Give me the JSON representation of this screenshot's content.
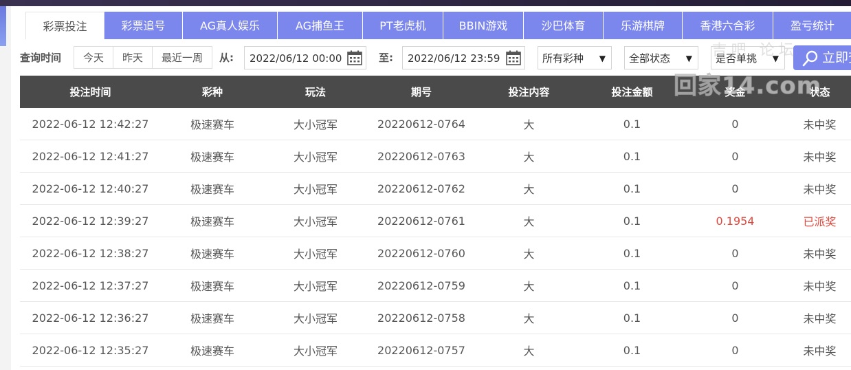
{
  "colors": {
    "accent": "#7c87ee",
    "header_bg": "#4a4a4a",
    "win_red": "#e0483d"
  },
  "tabs": [
    {
      "label": "彩票投注",
      "active": true
    },
    {
      "label": "彩票追号",
      "active": false
    },
    {
      "label": "AG真人娱乐",
      "active": false
    },
    {
      "label": "AG捕鱼王",
      "active": false
    },
    {
      "label": "PT老虎机",
      "active": false
    },
    {
      "label": "BBIN游戏",
      "active": false
    },
    {
      "label": "沙巴体育",
      "active": false
    },
    {
      "label": "乐游棋牌",
      "active": false
    },
    {
      "label": "香港六合彩",
      "active": false
    },
    {
      "label": "盈亏统计",
      "active": false
    }
  ],
  "filter": {
    "query_time_label": "查询时间",
    "quick": [
      "今天",
      "昨天",
      "最近一周"
    ],
    "from_label": "从:",
    "from_value": "2022/06/12 00:00",
    "to_label": "至:",
    "to_value": "2022/06/12 23:59",
    "lottery_select": "所有彩种",
    "status_select": "全部状态",
    "single_select": "是否单挑",
    "search_label": "立即查询",
    "calendar_icon": "calendar-icon",
    "search_icon": "search-icon"
  },
  "table": {
    "headers": [
      "投注时间",
      "彩种",
      "玩法",
      "期号",
      "投注内容",
      "投注金额",
      "奖金",
      "状态"
    ],
    "rows": [
      [
        "2022-06-12 12:42:27",
        "极速赛车",
        "大小冠军",
        "20220612-0764",
        "大",
        "0.1",
        "0",
        "未中奖"
      ],
      [
        "2022-06-12 12:41:27",
        "极速赛车",
        "大小冠军",
        "20220612-0763",
        "大",
        "0.1",
        "0",
        "未中奖"
      ],
      [
        "2022-06-12 12:40:27",
        "极速赛车",
        "大小冠军",
        "20220612-0762",
        "大",
        "0.1",
        "0",
        "未中奖"
      ],
      [
        "2022-06-12 12:39:27",
        "极速赛车",
        "大小冠军",
        "20220612-0761",
        "大",
        "0.1",
        "0.1954",
        "已派奖"
      ],
      [
        "2022-06-12 12:38:27",
        "极速赛车",
        "大小冠军",
        "20220612-0760",
        "大",
        "0.1",
        "0",
        "未中奖"
      ],
      [
        "2022-06-12 12:37:27",
        "极速赛车",
        "大小冠军",
        "20220612-0759",
        "大",
        "0.1",
        "0",
        "未中奖"
      ],
      [
        "2022-06-12 12:36:27",
        "极速赛车",
        "大小冠军",
        "20220612-0758",
        "大",
        "0.1",
        "0",
        "未中奖"
      ],
      [
        "2022-06-12 12:35:27",
        "极速赛车",
        "大小冠军",
        "20220612-0757",
        "大",
        "0.1",
        "0",
        "未中奖"
      ]
    ]
  },
  "watermark": {
    "top": "吉吧 论坛",
    "main": "回家14.com"
  }
}
